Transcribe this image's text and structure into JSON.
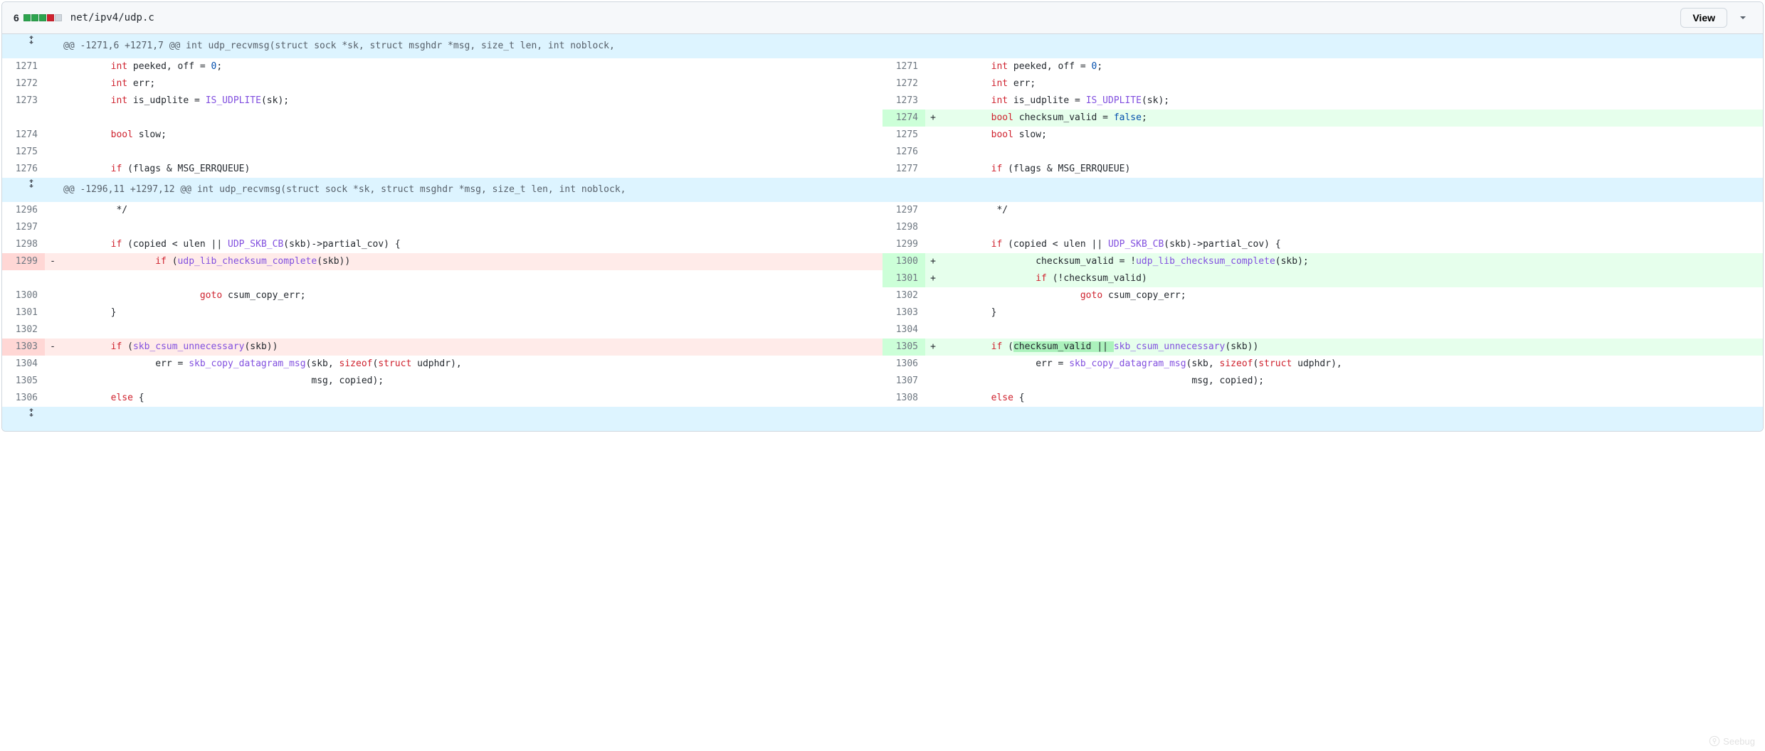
{
  "header": {
    "stat_count": "6",
    "filename": "net/ipv4/udp.c",
    "view_button": "View"
  },
  "hunks": [
    "@@ -1271,6 +1271,7 @@ int udp_recvmsg(struct sock *sk, struct msghdr *msg, size_t len, int noblock,",
    "@@ -1296,11 +1297,12 @@ int udp_recvmsg(struct sock *sk, struct msghdr *msg, size_t len, int noblock,"
  ],
  "lines": {
    "l1271": "1271",
    "l1272": "1272",
    "l1273": "1273",
    "l1274": "1274",
    "l1275": "1275",
    "l1276": "1276",
    "l1296": "1296",
    "l1297": "1297",
    "l1298": "1298",
    "l1299": "1299",
    "l1300": "1300",
    "l1301": "1301",
    "l1302": "1302",
    "l1303": "1303",
    "l1304": "1304",
    "l1305": "1305",
    "l1306": "1306",
    "r1271": "1271",
    "r1272": "1272",
    "r1273": "1273",
    "r1274": "1274",
    "r1275": "1275",
    "r1276": "1276",
    "r1277": "1277",
    "r1297": "1297",
    "r1298": "1298",
    "r1299": "1299",
    "r1300": "1300",
    "r1301": "1301",
    "r1302": "1302",
    "r1303": "1303",
    "r1304": "1304",
    "r1305": "1305",
    "r1306": "1306",
    "r1307": "1307",
    "r1308": "1308"
  },
  "markers": {
    "plus": "+",
    "minus": "-"
  },
  "code": {
    "peeked_a": "        ",
    "peeked_b": " peeked, off = ",
    "peeked_c": ";",
    "interr": " err;",
    "isudp_a": " is_udplite = ",
    "isudp_b": "(sk);",
    "cvalid_a": " checksum_valid = ",
    "cvalid_b": ";",
    "slow": " slow;",
    "empty": "",
    "flags_a": "        ",
    "flags_b": " (flags & MSG_ERRQUEUE)",
    "star": "         */",
    "ifcopied_a": "        ",
    "ifcopied_b": " (copied < ulen || ",
    "ifcopied_c": "(skb)->partial_cov) {",
    "ifudplib_a": "                ",
    "ifudplib_b": " (",
    "ifudplib_c": "(skb))",
    "cvset_a": "                checksum_valid = !",
    "cvset_b": "(skb);",
    "ifnot_a": "                ",
    "ifnot_b": " (!checksum_valid)",
    "goto_a": "                        ",
    "goto_b": " csum_copy_err;",
    "brace": "        }",
    "ifskb_a": "        ",
    "ifskb_b": " (",
    "ifskb_c": "(skb))",
    "ifskb2_b": " (",
    "ifskb2_hl": "checksum_valid || ",
    "ifskb2_c": "(skb))",
    "errcopy_a": "                err = ",
    "errcopy_b": "(skb, ",
    "errcopy_c": "(",
    "errcopy_d": " udphdr),",
    "msgc": "                                            msg, copied);",
    "else_a": "        ",
    "else_b": " {"
  },
  "kw": {
    "int": "int",
    "bool": "bool",
    "if": "if",
    "goto": "goto",
    "else": "else",
    "sizeof": "sizeof",
    "struct": "struct"
  },
  "fn": {
    "IS_UDPLITE": "IS_UDPLITE",
    "UDP_SKB_CB": "UDP_SKB_CB",
    "udp_lib_checksum_complete": "udp_lib_checksum_complete",
    "skb_csum_unnecessary": "skb_csum_unnecessary",
    "skb_copy_datagram_msg": "skb_copy_datagram_msg"
  },
  "const": {
    "zero": "0",
    "false": "false"
  },
  "watermark": "Seebug"
}
